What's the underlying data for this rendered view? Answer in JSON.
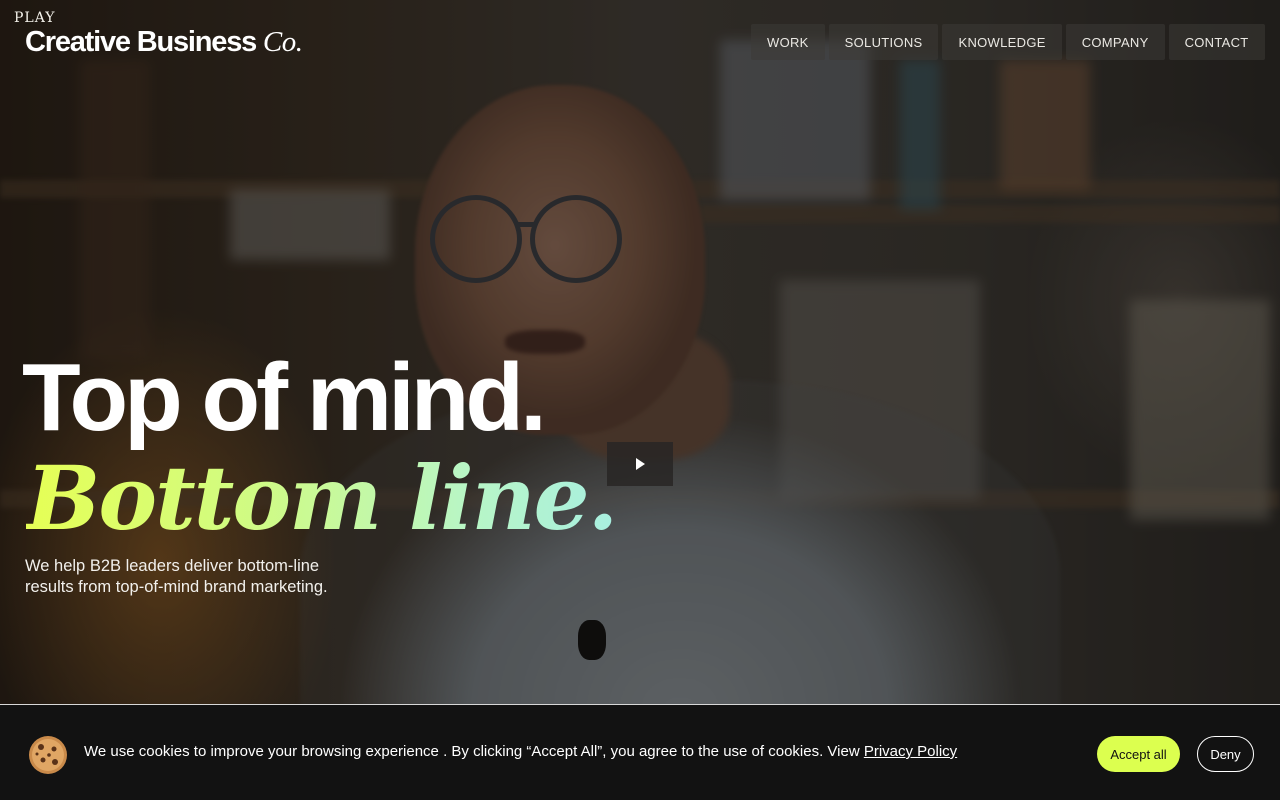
{
  "header": {
    "play_label": "PLAY",
    "logo_main": "Creative Business ",
    "logo_co": "Co.",
    "nav": [
      {
        "label": "WORK"
      },
      {
        "label": "SOLUTIONS"
      },
      {
        "label": "KNOWLEDGE"
      },
      {
        "label": "COMPANY"
      },
      {
        "label": "CONTACT"
      }
    ]
  },
  "hero": {
    "headline": "Top of mind.",
    "headline_2": "Bottom line.",
    "subtext": "We help B2B leaders deliver bottom-line results from top-of-mind brand marketing.",
    "play_button_icon": "play-icon"
  },
  "cookie": {
    "icon": "cookie-icon",
    "text": "We use cookies to improve your browsing experience . By clicking “Accept All”, you agree to the use of cookies. View ",
    "link": "Privacy Policy",
    "accept": "Accept all",
    "deny": "Deny"
  },
  "colors": {
    "accent": "#dcff4f",
    "cookie_bg": "#121212"
  }
}
